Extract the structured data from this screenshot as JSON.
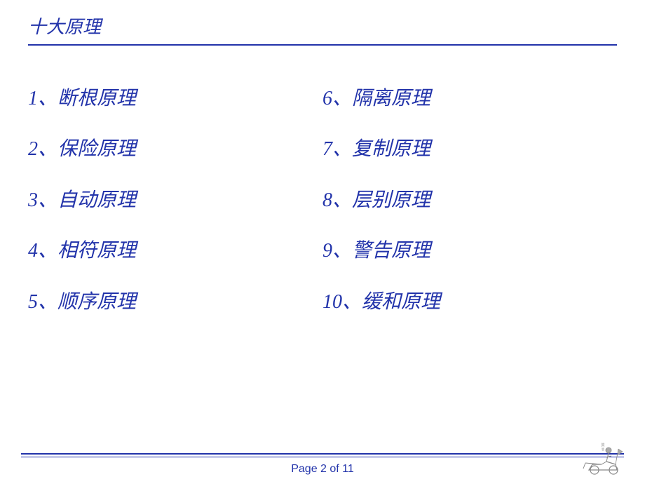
{
  "header": {
    "title": "十大原理",
    "line_color": "#2233aa"
  },
  "principles": {
    "left": [
      {
        "number": "1",
        "text": "、断根原理"
      },
      {
        "number": "2",
        "text": "、保险原理"
      },
      {
        "number": "3",
        "text": "、自动原理"
      },
      {
        "number": "4",
        "text": "、相符原理"
      },
      {
        "number": "5",
        "text": "、顺序原理"
      }
    ],
    "right": [
      {
        "number": "6",
        "text": "、隔离原理"
      },
      {
        "number": "7",
        "text": "、复制原理"
      },
      {
        "number": "8",
        "text": "、层别原理"
      },
      {
        "number": "9",
        "text": "、警告原理"
      },
      {
        "number": "10",
        "text": "、缓和原理"
      }
    ]
  },
  "footer": {
    "page_label": "Page",
    "current_page": "2",
    "of_label": "of",
    "total_pages": "11",
    "page_text": "Page 2 of 11"
  }
}
